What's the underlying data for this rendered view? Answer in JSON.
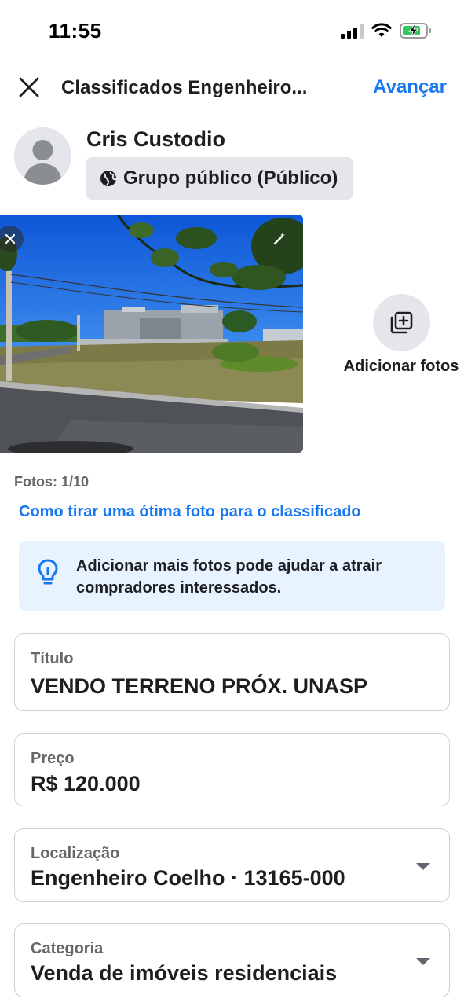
{
  "status_bar": {
    "time": "11:55"
  },
  "header": {
    "title": "Classificados Engenheiro...",
    "next_label": "Avançar"
  },
  "user": {
    "name": "Cris Custodio",
    "privacy_label": "Grupo público (Público)"
  },
  "photos": {
    "add_label": "Adicionar fotos",
    "count": "Fotos: 1/10",
    "tip_link": "Como tirar uma ótima foto para o classificado",
    "info_text": "Adicionar mais fotos pode ajudar a atrair compradores interessados."
  },
  "fields": {
    "title": {
      "label": "Título",
      "value": "VENDO TERRENO PRÓX. UNASP"
    },
    "price": {
      "label": "Preço",
      "value": "R$ 120.000"
    },
    "location": {
      "label": "Localização",
      "value": "Engenheiro Coelho · 13165-000"
    },
    "category": {
      "label": "Categoria",
      "value": "Venda de imóveis residenciais"
    }
  },
  "colors": {
    "accent": "#1877f2",
    "info_background": "#e7f3ff",
    "secondary_text": "#65676b",
    "chip_background": "#e4e6eb",
    "battery_charging": "#34c759"
  }
}
